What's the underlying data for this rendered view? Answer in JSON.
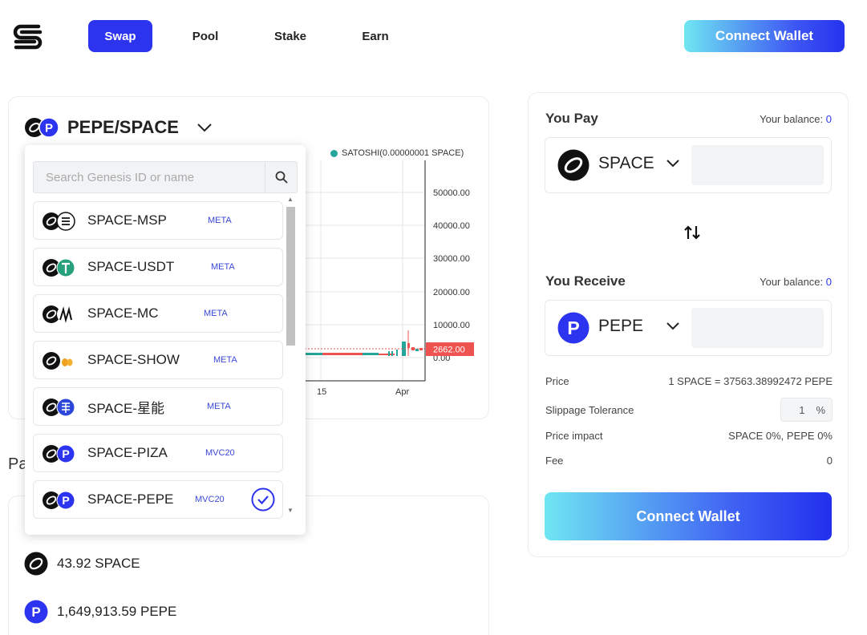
{
  "header": {
    "logo_icon": "s-logo-icon",
    "nav": [
      {
        "label": "Swap",
        "active": true
      },
      {
        "label": "Pool",
        "active": false
      },
      {
        "label": "Stake",
        "active": false
      },
      {
        "label": "Earn",
        "active": false
      }
    ],
    "connect_label": "Connect Wallet"
  },
  "pair": {
    "name": "PEPE/SPACE"
  },
  "chart": {
    "legend": "SATOSHI(0.00000001 SPACE)",
    "y_ticks": [
      "50000.00",
      "40000.00",
      "30000.00",
      "20000.00",
      "10000.00",
      "0.00"
    ],
    "x_ticks": [
      "15",
      "Apr"
    ],
    "last_price": "2662.00",
    "colors": {
      "up": "#26a69a",
      "down": "#ef5350",
      "price_tag": "#ef5350"
    }
  },
  "dropdown": {
    "search_placeholder": "Search Genesis ID or name",
    "items": [
      {
        "name": "SPACE-MSP",
        "type": "META",
        "icon": "msp-icon",
        "selected": false
      },
      {
        "name": "SPACE-USDT",
        "type": "META",
        "icon": "usdt-icon",
        "selected": false
      },
      {
        "name": "SPACE-MC",
        "type": "META",
        "icon": "mc-icon",
        "selected": false
      },
      {
        "name": "SPACE-SHOW",
        "type": "META",
        "icon": "show-icon",
        "selected": false
      },
      {
        "name": "SPACE-星能",
        "type": "META",
        "icon": "xingneng-icon",
        "selected": false
      },
      {
        "name": "SPACE-PIZA",
        "type": "MVC20",
        "icon": "piza-icon",
        "selected": false
      },
      {
        "name": "SPACE-PEPE",
        "type": "MVC20",
        "icon": "pepe-icon",
        "selected": true
      }
    ]
  },
  "pool_assets": {
    "label": "Pa",
    "rows": [
      {
        "text": "43.92 SPACE",
        "icon": "space-icon"
      },
      {
        "text": "1,649,913.59 PEPE",
        "icon": "pepe-icon"
      }
    ]
  },
  "swap": {
    "pay": {
      "title": "You Pay",
      "balance_label": "Your balance:",
      "balance": "0",
      "token": "SPACE",
      "amount": ""
    },
    "receive": {
      "title": "You Receive",
      "balance_label": "Your balance:",
      "balance": "0",
      "token": "PEPE",
      "amount": ""
    },
    "info": {
      "price_label": "Price",
      "price_value": "1 SPACE = 37563.38992472 PEPE",
      "slippage_label": "Slippage Tolerance",
      "slippage_value": "1",
      "slippage_unit": "%",
      "impact_label": "Price impact",
      "impact_value": "SPACE 0%, PEPE 0%",
      "fee_label": "Fee",
      "fee_value": "0"
    },
    "connect_label": "Connect Wallet",
    "accent": "#2d34f0"
  }
}
